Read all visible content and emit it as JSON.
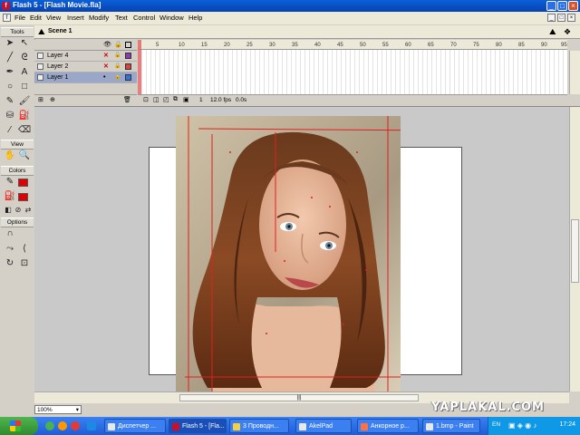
{
  "window": {
    "title": "Flash 5 - [Flash Movie.fla]"
  },
  "menu": [
    "File",
    "Edit",
    "View",
    "Insert",
    "Modify",
    "Text",
    "Control",
    "Window",
    "Help"
  ],
  "tools_panel": {
    "tools_label": "Tools",
    "view_label": "View",
    "colors_label": "Colors",
    "options_label": "Options"
  },
  "scene": {
    "name": "Scene 1"
  },
  "timeline": {
    "ticks": [
      "5",
      "10",
      "15",
      "20",
      "25",
      "30",
      "35",
      "40",
      "45",
      "50",
      "55",
      "60",
      "65",
      "70",
      "75",
      "80",
      "85",
      "90",
      "95"
    ],
    "layers": [
      {
        "name": "Layer 4",
        "color": "#8a3db0"
      },
      {
        "name": "Layer 2",
        "color": "#e04040"
      },
      {
        "name": "Layer 1",
        "color": "#3a6fe0"
      }
    ],
    "current_frame": "1",
    "fps": "12.0 fps",
    "elapsed": "0.0s"
  },
  "status": {
    "zoom": "100%"
  },
  "watermark": "YAPLAKAL.COM",
  "taskbar": {
    "items": [
      "Диспетчер ...",
      "Flash 5 - [Fla...",
      "3 Проводн...",
      "AkelPad",
      "Анкорное р...",
      "1.bmp - Paint"
    ],
    "language": "EN",
    "clock": "17:24"
  },
  "colors": {
    "titlebar": "#0a5fd8",
    "stage_bg": "#c9c9c9",
    "guide_red": "#e02020"
  }
}
